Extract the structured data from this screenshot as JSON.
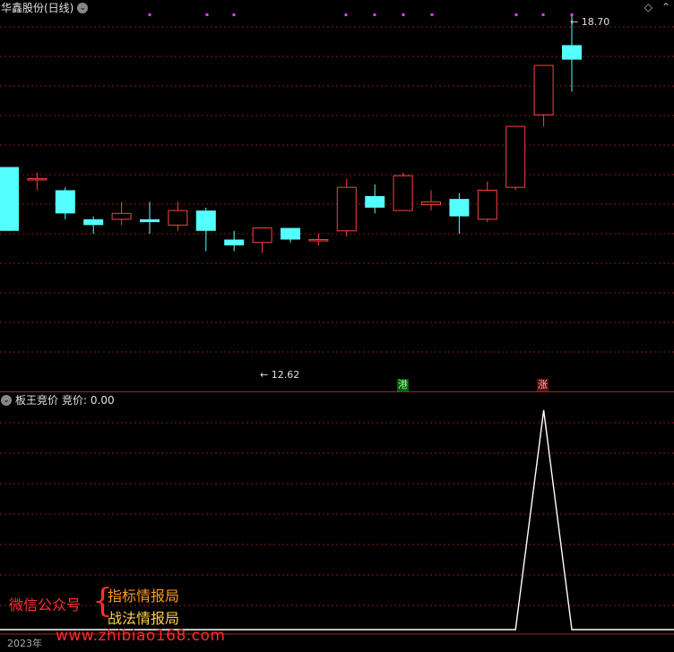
{
  "top_panel": {
    "title": "华鑫股份(日线)",
    "high_label": "18.70",
    "low_label": "12.62",
    "badges": {
      "gang": "港",
      "zhang": "涨"
    }
  },
  "bottom_panel": {
    "title": "板王竞价",
    "indicator_label": "竞价: 0.00"
  },
  "watermark": {
    "left": "微信公众号",
    "brace": "{",
    "right_top": "指标情报局",
    "right_bottom": "战法情报局",
    "site": "www.zhibiao168.com"
  },
  "xaxis": {
    "label": "2023年"
  },
  "colors": {
    "up": "#ff4040",
    "down": "#54ffff",
    "grid": "#8b1a1a",
    "marker": "#e040ff",
    "line": "#ffffff"
  },
  "chart_data": {
    "type": "candlestick",
    "candles": [
      {
        "o": 16.1,
        "h": 16.1,
        "l": 15.0,
        "c": 15.0
      },
      {
        "o": 15.9,
        "h": 16.0,
        "l": 15.7,
        "c": 15.9
      },
      {
        "o": 15.7,
        "h": 15.75,
        "l": 15.2,
        "c": 15.3
      },
      {
        "o": 15.2,
        "h": 15.25,
        "l": 14.95,
        "c": 15.1
      },
      {
        "o": 15.2,
        "h": 15.5,
        "l": 15.1,
        "c": 15.3
      },
      {
        "o": 15.2,
        "h": 15.5,
        "l": 14.95,
        "c": 15.15
      },
      {
        "o": 15.1,
        "h": 15.5,
        "l": 15.0,
        "c": 15.35
      },
      {
        "o": 15.35,
        "h": 15.4,
        "l": 14.65,
        "c": 15.0
      },
      {
        "o": 14.85,
        "h": 15.0,
        "l": 14.65,
        "c": 14.75
      },
      {
        "o": 14.8,
        "h": 15.05,
        "l": 14.62,
        "c": 15.05
      },
      {
        "o": 15.05,
        "h": 15.05,
        "l": 14.8,
        "c": 14.85
      },
      {
        "o": 14.85,
        "h": 14.95,
        "l": 14.75,
        "c": 14.85
      },
      {
        "o": 15.0,
        "h": 15.9,
        "l": 14.9,
        "c": 15.75
      },
      {
        "o": 15.6,
        "h": 15.8,
        "l": 15.3,
        "c": 15.4
      },
      {
        "o": 15.35,
        "h": 16.0,
        "l": 15.35,
        "c": 15.95
      },
      {
        "o": 15.45,
        "h": 15.7,
        "l": 15.35,
        "c": 15.5
      },
      {
        "o": 15.55,
        "h": 15.65,
        "l": 14.95,
        "c": 15.25
      },
      {
        "o": 15.2,
        "h": 15.85,
        "l": 15.15,
        "c": 15.7
      },
      {
        "o": 15.75,
        "h": 16.8,
        "l": 15.7,
        "c": 16.8
      },
      {
        "o": 17.0,
        "h": 17.85,
        "l": 16.8,
        "c": 17.85
      },
      {
        "o": 18.2,
        "h": 18.7,
        "l": 17.4,
        "c": 17.95
      }
    ],
    "y_high": 18.7,
    "y_low": 12.62,
    "indicator": [
      0,
      0,
      0,
      0,
      0,
      0,
      0,
      0,
      0,
      0,
      0,
      0,
      0,
      0,
      0,
      0,
      0,
      0,
      0,
      1,
      0
    ]
  }
}
